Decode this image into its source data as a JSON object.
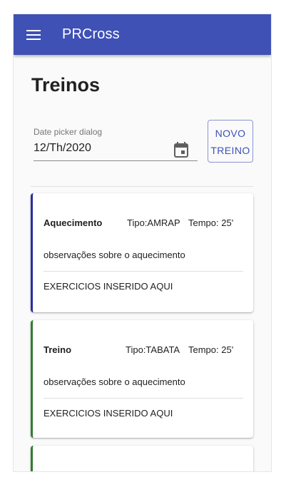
{
  "appbar": {
    "menu_icon": "menu-icon",
    "title": "PRCross",
    "color": "#3f51b5"
  },
  "page": {
    "title": "Treinos"
  },
  "date_picker": {
    "label": "Date picker dialog",
    "value": "12/Th/2020",
    "icon": "calendar-icon"
  },
  "new_button": {
    "line1": "NOVO",
    "line2": "TREINO"
  },
  "cards": [
    {
      "name": "Aquecimento",
      "tipo": "Tipo:AMRAP",
      "tempo": "Tempo: 25'",
      "obs": "observações sobre o aquecimento",
      "exercicios": "EXERCICIOS INSERIDO AQUI",
      "accent": "#2c2c9e"
    },
    {
      "name": "Treino",
      "tipo": "Tipo:TABATA",
      "tempo": "Tempo: 25'",
      "obs": "observações sobre o aquecimento",
      "exercicios": "EXERCICIOS INSERIDO AQUI",
      "accent": "#2e7d32"
    },
    {
      "accent": "#2e7d32"
    }
  ]
}
